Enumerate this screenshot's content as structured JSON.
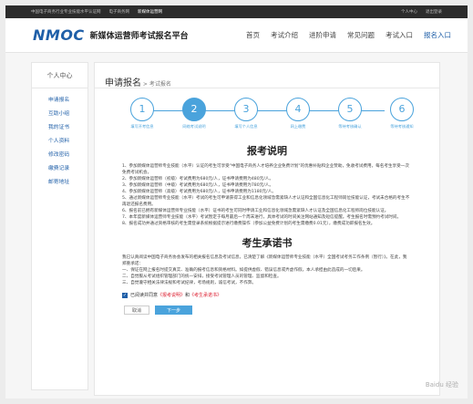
{
  "topbar": {
    "links": [
      "中国电子商务行业专业技能水平认证网",
      "电子商务网",
      "新媒体运营网"
    ],
    "active_index": 2,
    "right_links": [
      "个人中心",
      "退出登录"
    ]
  },
  "header": {
    "logo": "NMOC",
    "title": "新媒体运营师考试报名平台",
    "nav": [
      "首页",
      "考试介绍",
      "进阶申请",
      "常见问题",
      "考试入口",
      "报名入口"
    ],
    "active_index": 5
  },
  "sidebar": {
    "title": "个人中心",
    "items": [
      "申请报名",
      "互助小组",
      "我的证书",
      "个人资料",
      "修改密码",
      "缴费记录",
      "邮寄地址"
    ]
  },
  "main": {
    "breadcrumb_main": "申请报名",
    "breadcrumb_sep": " > ",
    "breadcrumb_sub": "考试报名",
    "steps": [
      {
        "num": "1",
        "label": "填写开考信息"
      },
      {
        "num": "2",
        "label": "网络考试说明"
      },
      {
        "num": "3",
        "label": "填写个人信息"
      },
      {
        "num": "4",
        "label": "网上缴费"
      },
      {
        "num": "5",
        "label": "等待考核确认"
      },
      {
        "num": "6",
        "label": "等待考核通知"
      }
    ],
    "active_step": 1,
    "notice_title": "报考说明",
    "notice_items": [
      "1、参加新媒体运营师专业技能（水平）认证的考生可享受\"中国电子商务人才培养企业免费计划\"的优惠补贴和企业赞助，免收考试费用，每名考生享受一次免费考试机会。",
      "2、参加新媒体运营师（初级）考试费用为680元/人，证书申请费用为480元/人。",
      "3、参加新媒体运营师（中级）考试费用为680元/人，证书申请费用为780元/人。",
      "4、参加新媒体运营师（高级）考试费用为680元/人，证书申请费用为1180元/人。",
      "5、通过新媒体运营师专业技能（水平）考试的考生可申请获得工业和信息化领域急需紧缺人才认证和全国信息化工程师岗位技能认证，考试未合格的考生不再退还报名费用。",
      "6、报名前已拥有新媒体运营师专业技能（水平）证书的考生可同时申请工业和信息化领域急需紧缺人才认证及全国信息化工程师岗位技能认证。",
      "7、本年度新媒体运营师专业技能（水平）考试暂定于每月最后一个周末进行，具体考试的时间关注网站通知及短信提醒。考生报名时需预约考试时间。",
      "8、报名成功并通过资格审核的考生需登录系统根据提示进行缴费操作（参加公益免费计划的考生需缴费0.01元），缴费成功即报名生效。"
    ],
    "promise_title": "考生承诺书",
    "promise_intro": "我已认真阅读中国电子商务协会发布的相关报名信息及考试信息，已清楚了解《新媒体运营师专业技能（水平）全国考试考务工作条例（暂行）》。在此，我郑重承诺：",
    "promise_items": [
      "一、保证在网上报名时提交真实、准确的报考信息和资格材料。如提供虚假、错误信息或弄虚作假，本人承担由此造成的一切后果。",
      "二、自觉服从考试组织管理部门的统一安排，接受考试管理人员的管理、监督和检查。",
      "三、自觉遵守相关法律法规和考试纪律，考场规则，诚信考试，不作弊。"
    ],
    "agree_prefix": "已阅读并同意",
    "agree_link1": "《报考说明》",
    "agree_and": "和",
    "agree_link2": "《考生承诺书》",
    "cancel_label": "取消",
    "next_label": "下一步"
  },
  "watermark": "Baidu 经验",
  "colors": {
    "accent": "#4aa3dc",
    "brand": "#1f5fa8",
    "dark_bar": "#2c2c2c"
  }
}
